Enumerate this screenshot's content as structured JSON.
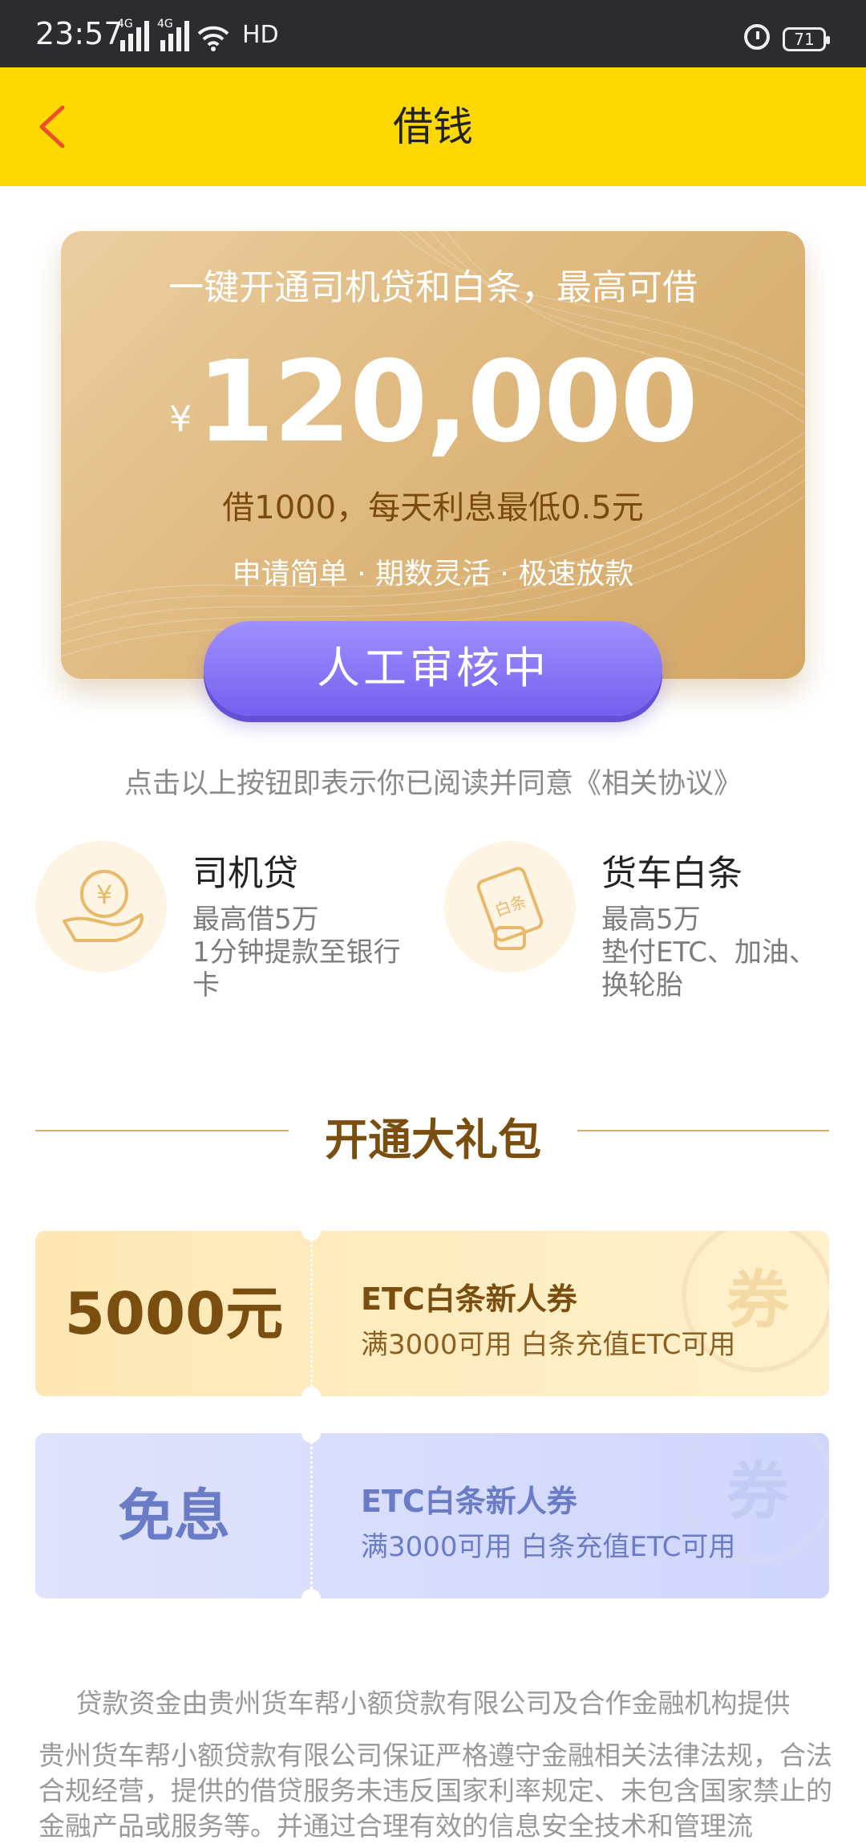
{
  "status_bar": {
    "time": "23:57",
    "net1": "4G",
    "net2": "4G",
    "hd": "HD",
    "battery": "71"
  },
  "header": {
    "title": "借钱"
  },
  "hero": {
    "headline": "一键开通司机贷和白条，最高可借",
    "currency": "¥",
    "amount": "120,000",
    "rate_text": "借1000，每天利息最低0.5元",
    "features": "申请简单 · 期数灵活 · 极速放款",
    "cta_label": "人工审核中"
  },
  "agreement": "点击以上按钮即表示你已阅读并同意《相关协议》",
  "products": [
    {
      "title": "司机贷",
      "line1": "最高借5万",
      "line2": "1分钟提款至银行卡",
      "icon_text": "¥"
    },
    {
      "title": "货车白条",
      "line1": "最高5万",
      "line2": "垫付ETC、加油、换轮胎",
      "icon_text": "白条"
    }
  ],
  "gift_section": {
    "title": "开通大礼包"
  },
  "coupons": [
    {
      "value": "5000元",
      "title": "ETC白条新人券",
      "desc": "满3000可用 白条充值ETC可用",
      "watermark": "券"
    },
    {
      "value": "免息",
      "title": "ETC白条新人券",
      "desc": "满3000可用 白条充值ETC可用",
      "watermark": "券"
    }
  ],
  "footer": {
    "provider": "贷款资金由贵州货车帮小额贷款有限公司及合作金融机构提供",
    "disclaimer": "贵州货车帮小额贷款有限公司保证严格遵守金融相关法律法规，合法合规经营，提供的借贷服务未违反国家利率规定、未包含国家禁止的金融产品或服务等。并通过合理有效的信息安全技术和管理流"
  },
  "colors": {
    "header": "#fed801",
    "cta": "#7f6df5",
    "gold_text": "#7a4e0f",
    "coupon_blue": "#6b7cc7"
  }
}
